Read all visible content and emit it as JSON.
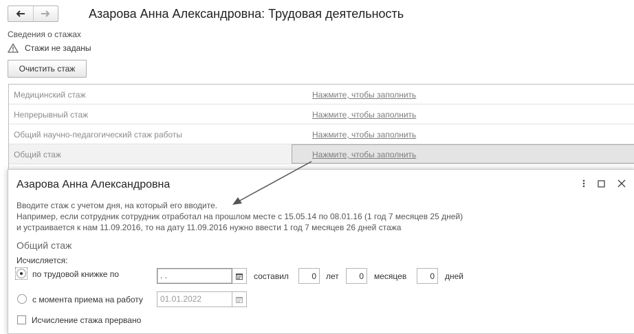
{
  "header": {
    "title": "Азарова Анна Александровна: Трудовая деятельность"
  },
  "seniority": {
    "section_label": "Сведения о стажах",
    "warning_text": "Стажи не заданы",
    "clear_button": "Очистить стаж",
    "rows": [
      {
        "name": "Медицинский стаж",
        "value": "Нажмите, чтобы заполнить"
      },
      {
        "name": "Непрерывный стаж",
        "value": "Нажмите, чтобы заполнить"
      },
      {
        "name": "Общий научно-педагогический стаж работы",
        "value": "Нажмите, чтобы заполнить"
      },
      {
        "name": "Общий стаж",
        "value": "Нажмите, чтобы заполнить"
      }
    ]
  },
  "dialog": {
    "title": "Азарова Анна Александровна",
    "hint_line1": "Вводите стаж с учетом дня, на который его вводите.",
    "hint_line2": "Например, если сотрудник сотрудник отработал на прошлом месте с 15.05.14 по 08.01.16 (1 год 7 месяцев 25 дней)",
    "hint_line3": "и устраивается к нам 11.09.2016, то на дату 11.09.2016 нужно ввести 1 год 7 месяцев 26 дней стажа",
    "group_title": "Общий стаж",
    "calc_label": "Исчисляется:",
    "option_workbook": "по трудовой книжке по",
    "workbook_date": " .  .",
    "composed_label": "составил",
    "years_value": "0",
    "years_label": "лет",
    "months_value": "0",
    "months_label": "месяцев",
    "days_value": "0",
    "days_label": "дней",
    "option_hire": "с момента приема на работу",
    "hire_date": "01.01.2022",
    "interrupted_label": "Исчисление стажа прервано"
  },
  "colors": {
    "link_gray": "#7d7d7d",
    "selected_cell": "#e4e4e4",
    "warning": "#666666"
  },
  "icons": [
    "arrow-left-icon",
    "arrow-right-icon",
    "warning-icon",
    "more-icon",
    "maximize-icon",
    "close-icon",
    "calendar-icon"
  ]
}
